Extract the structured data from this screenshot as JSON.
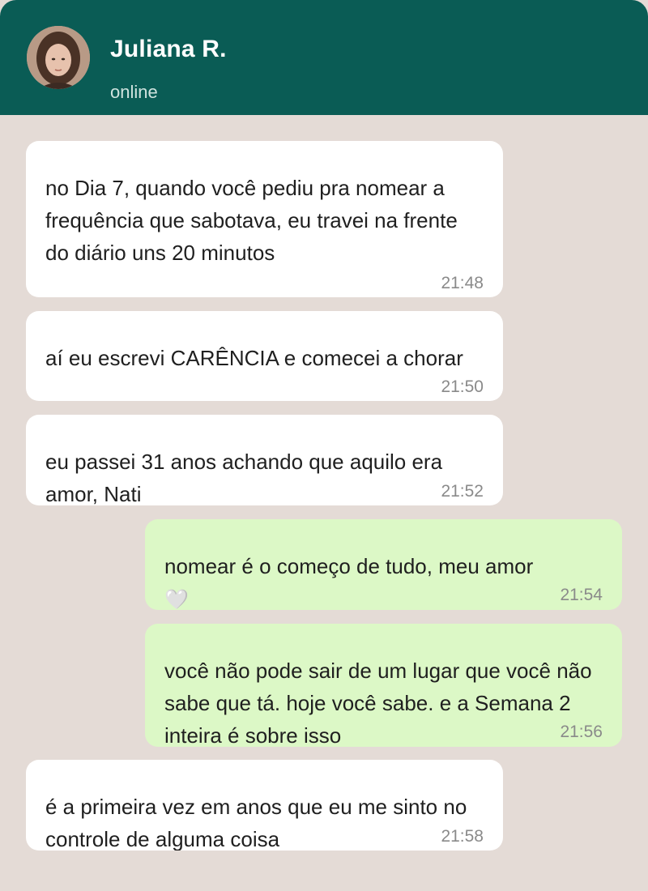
{
  "contact": {
    "name": "Juliana R.",
    "status": "online"
  },
  "messages": [
    {
      "direction": "incoming",
      "text": "no Dia 7, quando você pediu pra nomear a frequência que sabotava, eu travei na frente do diário uns 20 minutos",
      "time": "21:48"
    },
    {
      "direction": "incoming",
      "text": "aí eu escrevi CARÊNCIA e comecei a chorar",
      "time": "21:50"
    },
    {
      "direction": "incoming",
      "text": "eu passei 31 anos achando que aquilo era amor, Nati",
      "time": "21:52"
    },
    {
      "direction": "outgoing",
      "text": "nomear é o começo de tudo, meu amor",
      "emoji": "🤍",
      "time": "21:54"
    },
    {
      "direction": "outgoing",
      "text": "você não pode sair de um lugar que você não sabe que tá. hoje você sabe. e a Semana 2 inteira é sobre isso",
      "time": "21:56"
    },
    {
      "direction": "incoming",
      "text": "é a primeira vez em anos que eu me sinto no controle de alguma coisa",
      "time": "21:58"
    }
  ]
}
